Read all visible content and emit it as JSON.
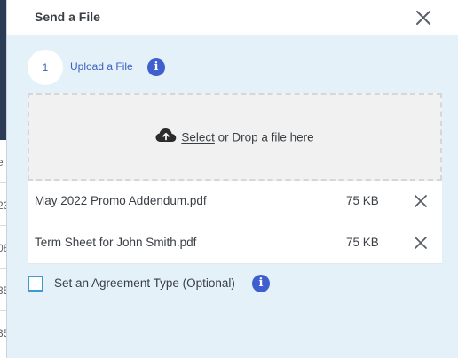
{
  "background": {
    "fragments": [
      "e",
      "23",
      "08",
      "35",
      "35"
    ]
  },
  "header": {
    "title": "Send a File"
  },
  "step": {
    "number": "1",
    "label": "Upload a File"
  },
  "dropzone": {
    "select_link": "Select",
    "text": " or Drop a file here"
  },
  "files": [
    {
      "name": "May 2022 Promo Addendum.pdf",
      "size": "75 KB"
    },
    {
      "name": "Term Sheet for John Smith.pdf",
      "size": "75 KB"
    }
  ],
  "agreement_type": {
    "label": "Set an Agreement Type (Optional)",
    "checked": false
  },
  "icons": {
    "info": "i",
    "close": "close-icon",
    "upload": "cloud-upload-icon",
    "remove": "close-icon"
  },
  "colors": {
    "accent": "#3f5fcf",
    "panel_bg": "#e4f1f9",
    "checkbox_border": "#3e9bcf"
  }
}
